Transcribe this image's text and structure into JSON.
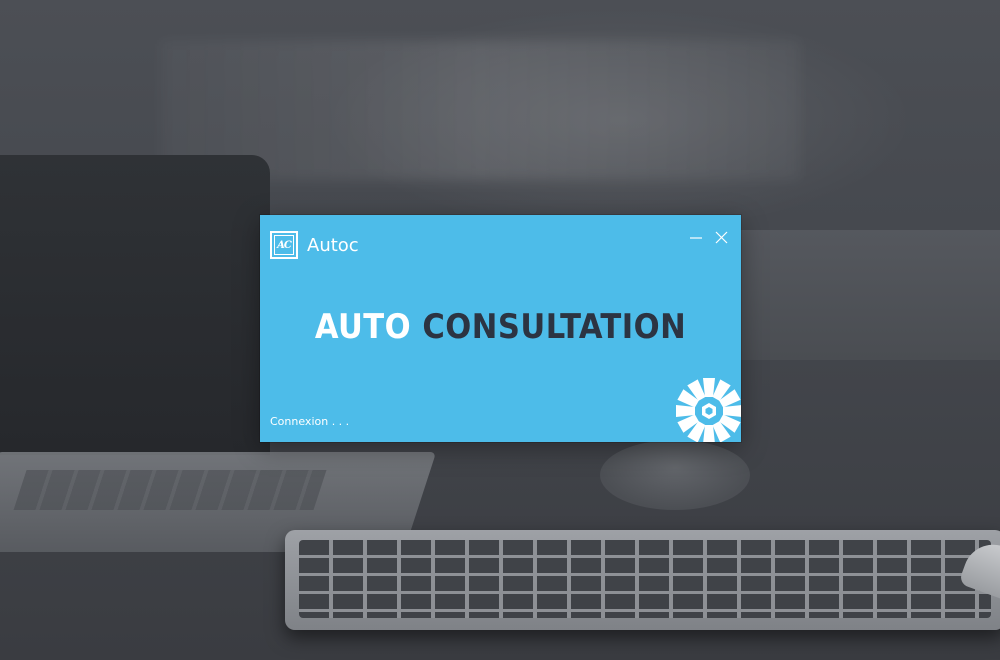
{
  "window": {
    "app_name": "Autoc",
    "logo_text": "AC",
    "minimize_icon": "minimize-icon",
    "close_icon": "close-icon"
  },
  "splash": {
    "headline_word1": "AUTO",
    "headline_word2": "CONSULTATION",
    "status_text": "Connexion . . .",
    "spinner_icon": "loading-spinner-icon"
  },
  "colors": {
    "window_bg": "#4dbce9",
    "headline_word1": "#ffffff",
    "headline_word2": "#2c3442",
    "text": "#ffffff"
  }
}
